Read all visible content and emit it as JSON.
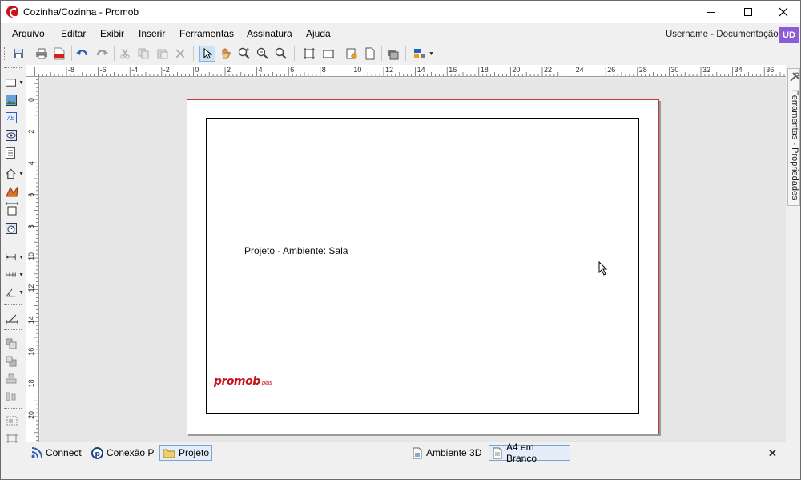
{
  "window": {
    "title": "Cozinha/Cozinha - Promob"
  },
  "menu": {
    "items": [
      "Arquivo",
      "Editar",
      "Exibir",
      "Inserir",
      "Ferramentas",
      "Assinatura",
      "Ajuda"
    ],
    "user_label": "Username - Documentação",
    "user_initials": "UD"
  },
  "ruler": {
    "top_labels": [
      "-8",
      "-6",
      "-4",
      "-2",
      "0",
      "2",
      "4",
      "6",
      "8",
      "10",
      "12",
      "14",
      "16",
      "18",
      "20",
      "22",
      "24",
      "26",
      "28",
      "30",
      "32",
      "34",
      "36"
    ],
    "left_labels": [
      "0",
      "2",
      "4",
      "6",
      "8",
      "10",
      "12",
      "14",
      "16",
      "18",
      "20"
    ]
  },
  "page": {
    "text": "Projeto - Ambiente: Sala",
    "logo": "promob",
    "logo_suffix": "plus"
  },
  "side_panel": {
    "label": "Ferramentas - Propriedades"
  },
  "status_tabs": {
    "connect": "Connect",
    "conexao": "Conexão P",
    "projeto": "Projeto",
    "ambiente3d": "Ambiente 3D",
    "a4": "A4 em Branco"
  },
  "colors": {
    "brand_red": "#c8141e",
    "user_badge": "#8b5cd6",
    "active_tab": "#e4eefa"
  }
}
